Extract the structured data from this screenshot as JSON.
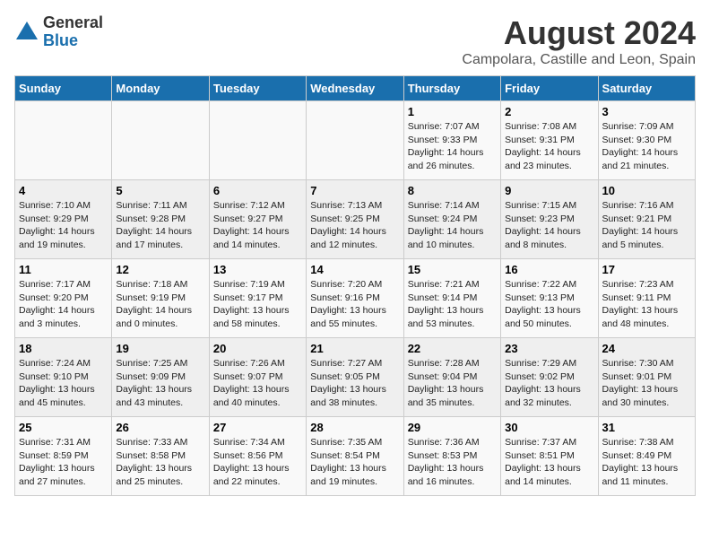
{
  "logo": {
    "general": "General",
    "blue": "Blue"
  },
  "title": "August 2024",
  "subtitle": "Campolara, Castille and Leon, Spain",
  "days_of_week": [
    "Sunday",
    "Monday",
    "Tuesday",
    "Wednesday",
    "Thursday",
    "Friday",
    "Saturday"
  ],
  "weeks": [
    [
      {
        "day": "",
        "info": ""
      },
      {
        "day": "",
        "info": ""
      },
      {
        "day": "",
        "info": ""
      },
      {
        "day": "",
        "info": ""
      },
      {
        "day": "1",
        "info": "Sunrise: 7:07 AM\nSunset: 9:33 PM\nDaylight: 14 hours and 26 minutes."
      },
      {
        "day": "2",
        "info": "Sunrise: 7:08 AM\nSunset: 9:31 PM\nDaylight: 14 hours and 23 minutes."
      },
      {
        "day": "3",
        "info": "Sunrise: 7:09 AM\nSunset: 9:30 PM\nDaylight: 14 hours and 21 minutes."
      }
    ],
    [
      {
        "day": "4",
        "info": "Sunrise: 7:10 AM\nSunset: 9:29 PM\nDaylight: 14 hours and 19 minutes."
      },
      {
        "day": "5",
        "info": "Sunrise: 7:11 AM\nSunset: 9:28 PM\nDaylight: 14 hours and 17 minutes."
      },
      {
        "day": "6",
        "info": "Sunrise: 7:12 AM\nSunset: 9:27 PM\nDaylight: 14 hours and 14 minutes."
      },
      {
        "day": "7",
        "info": "Sunrise: 7:13 AM\nSunset: 9:25 PM\nDaylight: 14 hours and 12 minutes."
      },
      {
        "day": "8",
        "info": "Sunrise: 7:14 AM\nSunset: 9:24 PM\nDaylight: 14 hours and 10 minutes."
      },
      {
        "day": "9",
        "info": "Sunrise: 7:15 AM\nSunset: 9:23 PM\nDaylight: 14 hours and 8 minutes."
      },
      {
        "day": "10",
        "info": "Sunrise: 7:16 AM\nSunset: 9:21 PM\nDaylight: 14 hours and 5 minutes."
      }
    ],
    [
      {
        "day": "11",
        "info": "Sunrise: 7:17 AM\nSunset: 9:20 PM\nDaylight: 14 hours and 3 minutes."
      },
      {
        "day": "12",
        "info": "Sunrise: 7:18 AM\nSunset: 9:19 PM\nDaylight: 14 hours and 0 minutes."
      },
      {
        "day": "13",
        "info": "Sunrise: 7:19 AM\nSunset: 9:17 PM\nDaylight: 13 hours and 58 minutes."
      },
      {
        "day": "14",
        "info": "Sunrise: 7:20 AM\nSunset: 9:16 PM\nDaylight: 13 hours and 55 minutes."
      },
      {
        "day": "15",
        "info": "Sunrise: 7:21 AM\nSunset: 9:14 PM\nDaylight: 13 hours and 53 minutes."
      },
      {
        "day": "16",
        "info": "Sunrise: 7:22 AM\nSunset: 9:13 PM\nDaylight: 13 hours and 50 minutes."
      },
      {
        "day": "17",
        "info": "Sunrise: 7:23 AM\nSunset: 9:11 PM\nDaylight: 13 hours and 48 minutes."
      }
    ],
    [
      {
        "day": "18",
        "info": "Sunrise: 7:24 AM\nSunset: 9:10 PM\nDaylight: 13 hours and 45 minutes."
      },
      {
        "day": "19",
        "info": "Sunrise: 7:25 AM\nSunset: 9:09 PM\nDaylight: 13 hours and 43 minutes."
      },
      {
        "day": "20",
        "info": "Sunrise: 7:26 AM\nSunset: 9:07 PM\nDaylight: 13 hours and 40 minutes."
      },
      {
        "day": "21",
        "info": "Sunrise: 7:27 AM\nSunset: 9:05 PM\nDaylight: 13 hours and 38 minutes."
      },
      {
        "day": "22",
        "info": "Sunrise: 7:28 AM\nSunset: 9:04 PM\nDaylight: 13 hours and 35 minutes."
      },
      {
        "day": "23",
        "info": "Sunrise: 7:29 AM\nSunset: 9:02 PM\nDaylight: 13 hours and 32 minutes."
      },
      {
        "day": "24",
        "info": "Sunrise: 7:30 AM\nSunset: 9:01 PM\nDaylight: 13 hours and 30 minutes."
      }
    ],
    [
      {
        "day": "25",
        "info": "Sunrise: 7:31 AM\nSunset: 8:59 PM\nDaylight: 13 hours and 27 minutes."
      },
      {
        "day": "26",
        "info": "Sunrise: 7:33 AM\nSunset: 8:58 PM\nDaylight: 13 hours and 25 minutes."
      },
      {
        "day": "27",
        "info": "Sunrise: 7:34 AM\nSunset: 8:56 PM\nDaylight: 13 hours and 22 minutes."
      },
      {
        "day": "28",
        "info": "Sunrise: 7:35 AM\nSunset: 8:54 PM\nDaylight: 13 hours and 19 minutes."
      },
      {
        "day": "29",
        "info": "Sunrise: 7:36 AM\nSunset: 8:53 PM\nDaylight: 13 hours and 16 minutes."
      },
      {
        "day": "30",
        "info": "Sunrise: 7:37 AM\nSunset: 8:51 PM\nDaylight: 13 hours and 14 minutes."
      },
      {
        "day": "31",
        "info": "Sunrise: 7:38 AM\nSunset: 8:49 PM\nDaylight: 13 hours and 11 minutes."
      }
    ]
  ]
}
